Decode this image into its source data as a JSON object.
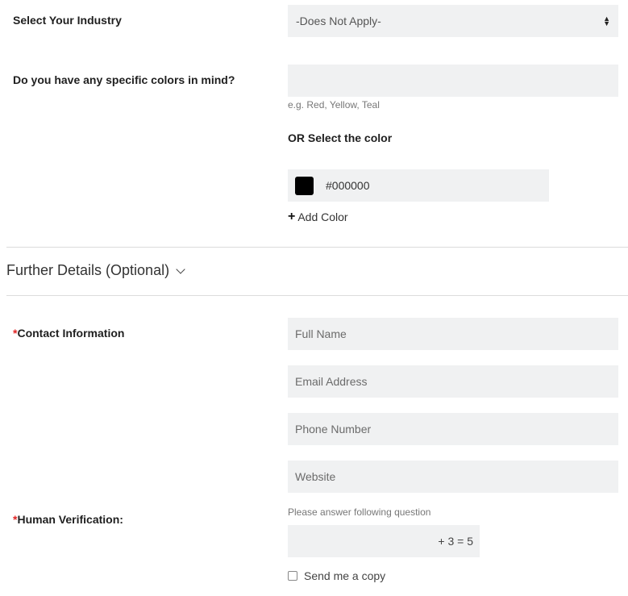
{
  "industry": {
    "label": "Select Your Industry",
    "selected": "-Does Not Apply-"
  },
  "colors": {
    "label": "Do you have any specific colors in mind?",
    "input_value": "",
    "help": "e.g. Red, Yellow, Teal",
    "or_label": "OR Select the color",
    "picker_value": "#000000",
    "swatch_color": "#000000",
    "add_label": "Add Color"
  },
  "further": {
    "title": "Further Details (Optional)"
  },
  "contact": {
    "required_mark": "*",
    "label": "Contact Information",
    "full_name_placeholder": "Full Name",
    "email_placeholder": "Email Address",
    "phone_placeholder": "Phone Number",
    "website_placeholder": "Website"
  },
  "verification": {
    "required_mark": "*",
    "label": "Human Verification:",
    "help": "Please answer following question",
    "question": "+ 3 = 5",
    "copy_label": "Send me a copy"
  }
}
